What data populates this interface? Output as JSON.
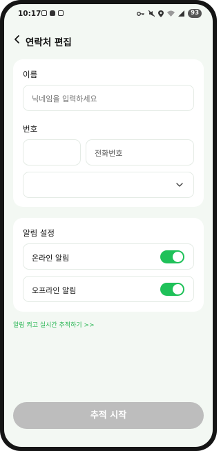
{
  "status_bar": {
    "time": "10:17",
    "battery": "93",
    "left_icons": [
      "screenshot-icon",
      "cat-icon",
      "card-icon"
    ],
    "right_icons": [
      "key-icon",
      "mute-icon",
      "location-icon",
      "wifi-icon",
      "signal-icon"
    ]
  },
  "header": {
    "title": "연락처 편집"
  },
  "form": {
    "name_label": "이름",
    "name_placeholder": "닉네임을 입력하세요",
    "number_label": "번호",
    "country_code_value": "",
    "phone_placeholder": "전화번호",
    "dropdown_value": ""
  },
  "alerts": {
    "section_label": "알림 설정",
    "online_label": "온라인 알림",
    "online_on": true,
    "offline_label": "오프라인 알림",
    "offline_on": true
  },
  "link_text": "알림 켜고 실시간 추적하기 >>",
  "start_button": "추적 시작",
  "colors": {
    "accent": "#1fc159",
    "background": "#f3f8f3",
    "disabled_button": "#bdbdbd"
  }
}
